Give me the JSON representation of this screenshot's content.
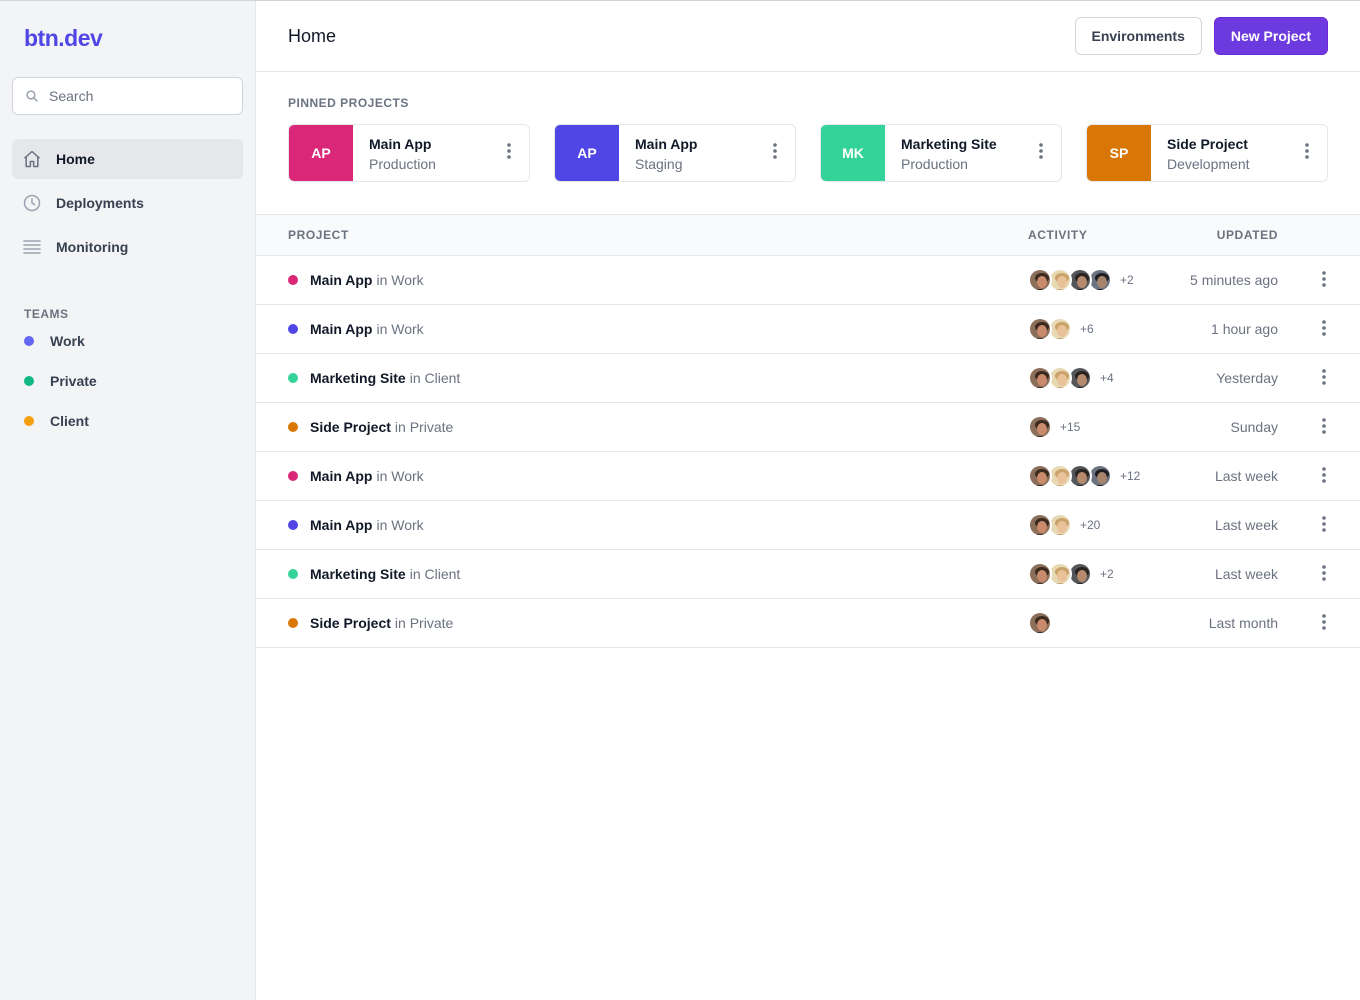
{
  "brand": {
    "logo": "btn.dev",
    "accent": "#4f46e5"
  },
  "search": {
    "placeholder": "Search",
    "value": ""
  },
  "nav": [
    {
      "label": "Home",
      "icon": "home-icon",
      "active": true
    },
    {
      "label": "Deployments",
      "icon": "clock-icon",
      "active": false
    },
    {
      "label": "Monitoring",
      "icon": "list-icon",
      "active": false
    }
  ],
  "teams": {
    "title": "TEAMS",
    "items": [
      {
        "label": "Work",
        "color": "#6366f1"
      },
      {
        "label": "Private",
        "color": "#10b981"
      },
      {
        "label": "Client",
        "color": "#f59e0b"
      }
    ]
  },
  "header": {
    "title": "Home",
    "environments_label": "Environments",
    "new_project_label": "New Project"
  },
  "pinned": {
    "title": "PINNED PROJECTS",
    "items": [
      {
        "initials": "AP",
        "name": "Main App",
        "env": "Production",
        "color": "#db2777"
      },
      {
        "initials": "AP",
        "name": "Main App",
        "env": "Staging",
        "color": "#4f46e5"
      },
      {
        "initials": "MK",
        "name": "Marketing Site",
        "env": "Production",
        "color": "#34d399"
      },
      {
        "initials": "SP",
        "name": "Side Project",
        "env": "Development",
        "color": "#d97706"
      }
    ]
  },
  "table": {
    "headers": {
      "project": "PROJECT",
      "activity": "ACTIVITY",
      "updated": "UPDATED"
    },
    "rows": [
      {
        "name": "Main App",
        "in_team": "in Work",
        "color": "#db2777",
        "avatars": 4,
        "more": "+2",
        "updated": "5 minutes ago"
      },
      {
        "name": "Main App",
        "in_team": "in Work",
        "color": "#4f46e5",
        "avatars": 2,
        "more": "+6",
        "updated": "1 hour ago"
      },
      {
        "name": "Marketing Site",
        "in_team": "in Client",
        "color": "#34d399",
        "avatars": 3,
        "more": "+4",
        "updated": "Yesterday"
      },
      {
        "name": "Side Project",
        "in_team": "in Private",
        "color": "#d97706",
        "avatars": 1,
        "more": "+15",
        "updated": "Sunday"
      },
      {
        "name": "Main App",
        "in_team": "in Work",
        "color": "#db2777",
        "avatars": 4,
        "more": "+12",
        "updated": "Last week"
      },
      {
        "name": "Main App",
        "in_team": "in Work",
        "color": "#4f46e5",
        "avatars": 2,
        "more": "+20",
        "updated": "Last week"
      },
      {
        "name": "Marketing Site",
        "in_team": "in Client",
        "color": "#34d399",
        "avatars": 3,
        "more": "+2",
        "updated": "Last week"
      },
      {
        "name": "Side Project",
        "in_team": "in Private",
        "color": "#d97706",
        "avatars": 1,
        "more": "",
        "updated": "Last month"
      }
    ]
  }
}
